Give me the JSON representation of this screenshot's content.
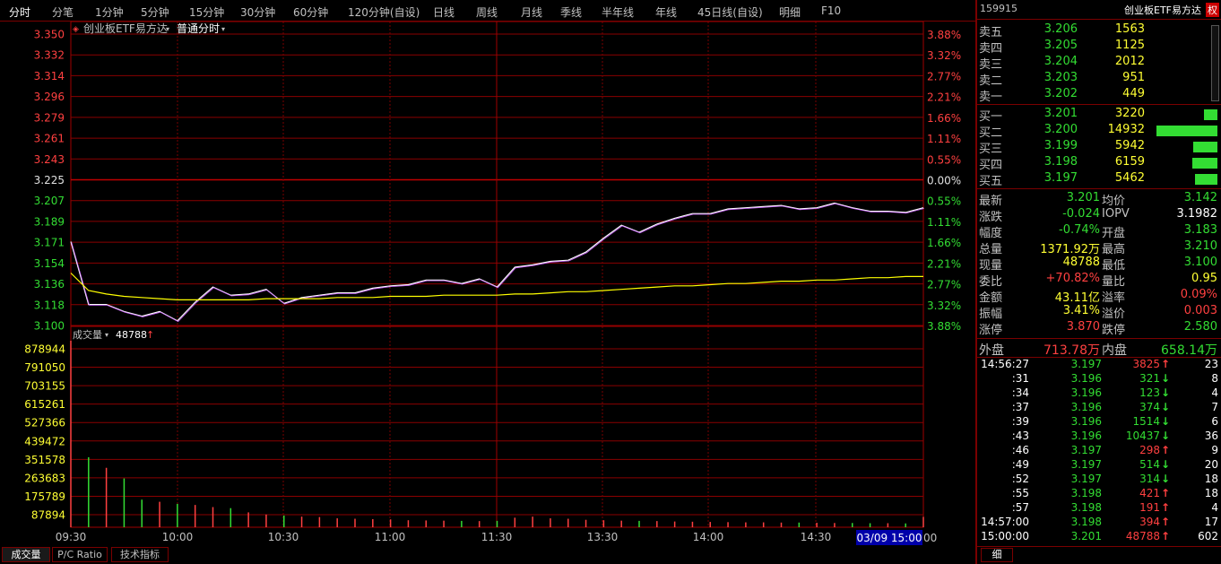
{
  "tabs": [
    "分时",
    "分笔",
    "1分钟",
    "5分钟",
    "15分钟",
    "30分钟",
    "60分钟",
    "120分钟(自设)",
    "日线",
    "周线",
    "月线",
    "季线",
    "半年线",
    "年线",
    "45日线(自设)",
    "明细",
    "F10"
  ],
  "chart": {
    "instrument_label": "创业板ETF易方达",
    "mode_label": "普通分时",
    "price_ticks": [
      "3.350",
      "3.332",
      "3.314",
      "3.296",
      "3.279",
      "3.261",
      "3.243",
      "3.225",
      "3.207",
      "3.189",
      "3.171",
      "3.154",
      "3.136",
      "3.118",
      "3.100"
    ],
    "pct_ticks": [
      "3.88%",
      "3.32%",
      "2.77%",
      "2.21%",
      "1.66%",
      "1.11%",
      "0.55%",
      "0.00%",
      "0.55%",
      "1.11%",
      "1.66%",
      "2.21%",
      "2.77%",
      "3.32%",
      "3.88%"
    ],
    "volume_label": "成交量",
    "volume_value": "48788",
    "volume_ticks": [
      "878944",
      "791050",
      "703155",
      "615261",
      "527366",
      "439472",
      "351578",
      "263683",
      "175789",
      "87894"
    ],
    "time_labels": [
      "09:30",
      "10:00",
      "10:30",
      "11:00",
      "11:30",
      "13:30",
      "14:00",
      "14:30"
    ],
    "cursor_time": "03/09 15:00",
    "end_label": "00",
    "bottom_tabs": [
      "成交量",
      "P/C Ratio",
      "技术指标"
    ]
  },
  "chart_data": {
    "type": "line",
    "title": "创业板ETF易方达 普通分时",
    "prev_close": 3.225,
    "ylim": [
      3.1,
      3.35
    ],
    "x": [
      "09:30",
      "09:35",
      "09:40",
      "09:45",
      "09:50",
      "09:55",
      "10:00",
      "10:05",
      "10:10",
      "10:15",
      "10:20",
      "10:25",
      "10:30",
      "10:35",
      "10:40",
      "10:45",
      "10:50",
      "10:55",
      "11:00",
      "11:05",
      "11:10",
      "11:15",
      "11:20",
      "11:25",
      "11:30",
      "13:05",
      "13:10",
      "13:15",
      "13:20",
      "13:25",
      "13:30",
      "13:35",
      "13:40",
      "13:45",
      "13:50",
      "13:55",
      "14:00",
      "14:05",
      "14:10",
      "14:15",
      "14:20",
      "14:25",
      "14:30",
      "14:35",
      "14:40",
      "14:45",
      "14:50",
      "14:55",
      "15:00"
    ],
    "series": [
      {
        "name": "price",
        "color": "#ffffff",
        "values": [
          3.172,
          3.118,
          3.118,
          3.112,
          3.108,
          3.112,
          3.104,
          3.12,
          3.133,
          3.126,
          3.127,
          3.131,
          3.119,
          3.124,
          3.126,
          3.128,
          3.128,
          3.132,
          3.134,
          3.135,
          3.139,
          3.139,
          3.136,
          3.14,
          3.133,
          3.15,
          3.152,
          3.155,
          3.156,
          3.163,
          3.175,
          3.186,
          3.18,
          3.187,
          3.192,
          3.196,
          3.196,
          3.2,
          3.201,
          3.202,
          3.203,
          3.2,
          3.201,
          3.205,
          3.201,
          3.198,
          3.198,
          3.197,
          3.201
        ]
      },
      {
        "name": "avg",
        "color": "#ffff00",
        "values": [
          3.145,
          3.13,
          3.127,
          3.125,
          3.124,
          3.123,
          3.122,
          3.122,
          3.122,
          3.122,
          3.122,
          3.123,
          3.123,
          3.123,
          3.123,
          3.124,
          3.124,
          3.124,
          3.125,
          3.125,
          3.125,
          3.126,
          3.126,
          3.126,
          3.126,
          3.127,
          3.127,
          3.128,
          3.129,
          3.129,
          3.13,
          3.131,
          3.132,
          3.133,
          3.134,
          3.134,
          3.135,
          3.136,
          3.136,
          3.137,
          3.138,
          3.138,
          3.139,
          3.139,
          3.14,
          3.141,
          3.141,
          3.142,
          3.142
        ]
      }
    ],
    "volume": [
      878944,
      330000,
      280000,
      230000,
      130000,
      120000,
      110000,
      105000,
      95000,
      90000,
      70000,
      60000,
      55000,
      50000,
      48000,
      42000,
      40000,
      38000,
      37000,
      33000,
      32000,
      31000,
      30000,
      29000,
      30000,
      45000,
      50000,
      42000,
      40000,
      35000,
      33000,
      31000,
      30000,
      29000,
      27000,
      26000,
      25000,
      24000,
      23000,
      23000,
      22000,
      22000,
      21000,
      20000,
      20000,
      19000,
      19000,
      18000,
      48788
    ],
    "volume_ylim": [
      0,
      878944
    ]
  },
  "quote": {
    "code": "159915",
    "name": "创业板ETF易方达",
    "badge": "权",
    "asks": [
      {
        "label": "卖五",
        "price": "3.206",
        "vol": "1563",
        "frac": 0.105
      },
      {
        "label": "卖四",
        "price": "3.205",
        "vol": "1125",
        "frac": 0.075
      },
      {
        "label": "卖三",
        "price": "3.204",
        "vol": "2012",
        "frac": 0.135
      },
      {
        "label": "卖二",
        "price": "3.203",
        "vol": "951",
        "frac": 0.064
      },
      {
        "label": "卖一",
        "price": "3.202",
        "vol": "449",
        "frac": 0.03
      }
    ],
    "bids": [
      {
        "label": "买一",
        "price": "3.201",
        "vol": "3220",
        "frac": 0.216
      },
      {
        "label": "买二",
        "price": "3.200",
        "vol": "14932",
        "frac": 1.0
      },
      {
        "label": "买三",
        "price": "3.199",
        "vol": "5942",
        "frac": 0.398
      },
      {
        "label": "买四",
        "price": "3.198",
        "vol": "6159",
        "frac": 0.412
      },
      {
        "label": "买五",
        "price": "3.197",
        "vol": "5462",
        "frac": 0.366
      }
    ],
    "stats": [
      {
        "l1": "最新",
        "v1": "3.201",
        "c1": "green",
        "l2": "均价",
        "v2": "3.142",
        "c2": "green"
      },
      {
        "l1": "涨跌",
        "v1": "-0.024",
        "c1": "green",
        "l2": "IOPV",
        "v2": "3.1982",
        "c2": "white"
      },
      {
        "l1": "幅度",
        "v1": "-0.74%",
        "c1": "green",
        "l2": "开盘",
        "v2": "3.183",
        "c2": "green"
      },
      {
        "l1": "总量",
        "v1": "1371.92万",
        "c1": "yellow",
        "l2": "最高",
        "v2": "3.210",
        "c2": "green"
      },
      {
        "l1": "现量",
        "v1": "48788",
        "c1": "yellow",
        "l2": "最低",
        "v2": "3.100",
        "c2": "green"
      },
      {
        "l1": "委比",
        "v1": "+70.82%",
        "c1": "red",
        "l2": "量比",
        "v2": "0.95",
        "c2": "yellow"
      },
      {
        "l1": "金额",
        "v1": "43.11亿",
        "c1": "yellow",
        "l2": "溢率",
        "v2": "0.09%",
        "c2": "red"
      },
      {
        "l1": "振幅",
        "v1": "3.41%",
        "c1": "yellow",
        "l2": "溢价",
        "v2": "0.003",
        "c2": "red"
      },
      {
        "l1": "涨停",
        "v1": "3.870",
        "c1": "red",
        "l2": "跌停",
        "v2": "2.580",
        "c2": "green"
      }
    ],
    "outer_label": "外盘",
    "outer_value": "713.78万",
    "inner_label": "内盘",
    "inner_value": "658.14万",
    "ticks": [
      {
        "time": "14:56:27",
        "price": "3.197",
        "vol": "3825",
        "dir": "up",
        "num": "23"
      },
      {
        "time": ":31",
        "price": "3.196",
        "vol": "321",
        "dir": "down",
        "num": "8"
      },
      {
        "time": ":34",
        "price": "3.196",
        "vol": "123",
        "dir": "down",
        "num": "4"
      },
      {
        "time": ":37",
        "price": "3.196",
        "vol": "374",
        "dir": "down",
        "num": "7"
      },
      {
        "time": ":39",
        "price": "3.196",
        "vol": "1514",
        "dir": "down",
        "num": "6"
      },
      {
        "time": ":43",
        "price": "3.196",
        "vol": "10437",
        "dir": "down",
        "num": "36"
      },
      {
        "time": ":46",
        "price": "3.197",
        "vol": "298",
        "dir": "up",
        "num": "9"
      },
      {
        "time": ":49",
        "price": "3.197",
        "vol": "514",
        "dir": "down",
        "num": "20"
      },
      {
        "time": ":52",
        "price": "3.197",
        "vol": "314",
        "dir": "down",
        "num": "18"
      },
      {
        "time": ":55",
        "price": "3.198",
        "vol": "421",
        "dir": "up",
        "num": "18"
      },
      {
        "time": ":57",
        "price": "3.198",
        "vol": "191",
        "dir": "up",
        "num": "4"
      },
      {
        "time": "14:57:00",
        "price": "3.198",
        "vol": "394",
        "dir": "up",
        "num": "17"
      },
      {
        "time": "15:00:00",
        "price": "3.201",
        "vol": "48788",
        "dir": "up",
        "num": "602"
      }
    ],
    "detail_tab": "细"
  }
}
